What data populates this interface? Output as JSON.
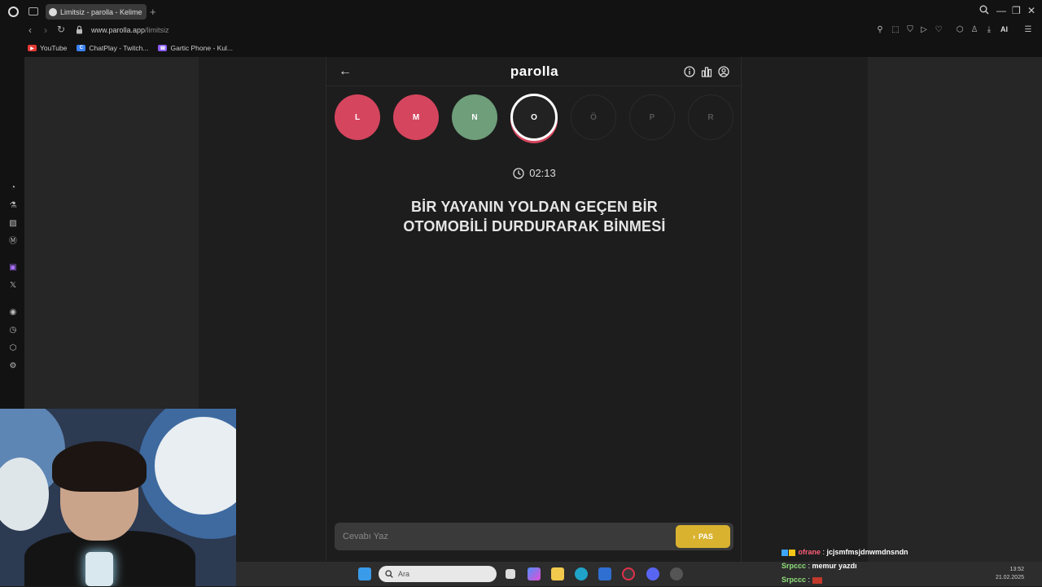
{
  "browser": {
    "tab_title": "Limitsiz - parolla - Kelime",
    "url_domain": "www.parolla.app",
    "url_path": "/limitsiz",
    "ai_label": "AI",
    "bookmarks": [
      {
        "label": "YouTube",
        "icon": "youtube-icon",
        "color": "#e53935"
      },
      {
        "label": "ChatPlay - Twitch...",
        "icon": "chatplay-icon",
        "color": "#3b82f6"
      },
      {
        "label": "Gartic Phone - Kul...",
        "icon": "gartic-icon",
        "color": "#8b5cf6"
      }
    ]
  },
  "app": {
    "logo": "parolla",
    "letters": [
      {
        "char": "L",
        "state": "wrong"
      },
      {
        "char": "M",
        "state": "wrong"
      },
      {
        "char": "N",
        "state": "correct"
      },
      {
        "char": "O",
        "state": "current"
      },
      {
        "char": "Ö",
        "state": "pending"
      },
      {
        "char": "P",
        "state": "pending"
      },
      {
        "char": "R",
        "state": "pending"
      }
    ],
    "timer": "02:13",
    "question_line1": "BİR YAYANIN YOLDAN GEÇEN BİR",
    "question_line2": "OTOMOBİLİ DURDURARAK BİNMESİ",
    "answer_placeholder": "Cevabı Yaz",
    "pass_label": "PAS",
    "colors": {
      "wrong": "#d6455e",
      "correct": "#6f9e7a",
      "pass": "#d9b330"
    }
  },
  "taskbar": {
    "search_placeholder": "Ara",
    "time": "13:52",
    "date": "21.02.2025"
  },
  "chat": [
    {
      "user": "ofrane",
      "message": "jcjsmfmsjdnwmdnsndn"
    },
    {
      "user": "Srpccc",
      "message": "memur yazdı"
    },
    {
      "user": "Srpccc",
      "message": ""
    }
  ]
}
